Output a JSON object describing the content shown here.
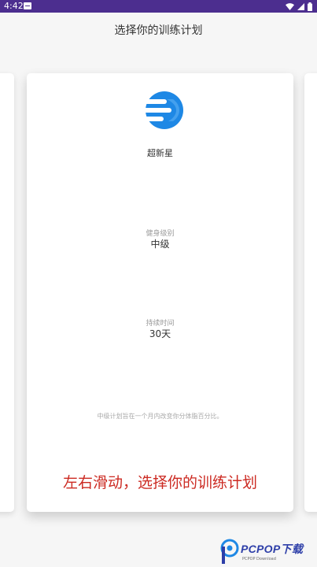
{
  "status_bar": {
    "time": "4:42",
    "icons": [
      "notification-icon",
      "wifi-icon",
      "signal-icon",
      "battery-icon"
    ],
    "background": "#4c2e8f"
  },
  "header": {
    "title": "选择你的训练计划"
  },
  "plan_card": {
    "logo_icon": "plan-logo-icon",
    "accent_color": "#1e88e5",
    "level_name": "超新星",
    "fitness_level_label": "健身级别",
    "fitness_level_value": "中级",
    "duration_label": "持续时间",
    "duration_value": "30天",
    "description": "中级计划旨在一个月内改变你分体脂百分比。"
  },
  "overlay": {
    "caption": "左右滑动，选择你的训练计划",
    "color": "#cc2a22"
  },
  "watermark": {
    "text": "PCPOP下载",
    "subtext": "PCPOP Download"
  }
}
